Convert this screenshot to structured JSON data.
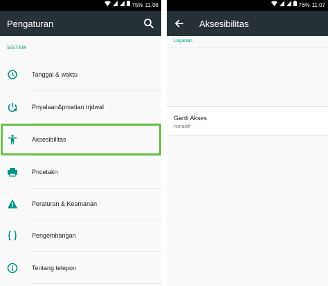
{
  "colors": {
    "toolbar": "#263238",
    "accent": "#009688",
    "highlight": "#6dbf4b",
    "icon": "#009688"
  },
  "left": {
    "status": {
      "battery": "75%",
      "time": "11.08"
    },
    "toolbar": {
      "title": "Pengaturan",
      "search_icon": "search-icon"
    },
    "section": "SISTEM",
    "items": [
      {
        "label": "Tanggal & waktu",
        "icon": "clock-icon"
      },
      {
        "label": "Pnyalaan&pmatian trjdwal",
        "icon": "power-schedule-icon"
      },
      {
        "label": "Aksesibilitas",
        "icon": "accessibility-icon",
        "highlighted": true
      },
      {
        "label": "Pncetakn",
        "icon": "printer-icon"
      },
      {
        "label": "Peraturan & Keamanan",
        "icon": "warning-icon"
      },
      {
        "label": "Pengembangan",
        "icon": "braces-icon"
      },
      {
        "label": "Tentang telepon",
        "icon": "info-icon"
      }
    ]
  },
  "right": {
    "status": {
      "battery": "76%",
      "time": "11.07"
    },
    "toolbar": {
      "title": "Aksesibilitas",
      "back_icon": "arrow-back-icon"
    },
    "section": "Layanan",
    "preference": {
      "title": "Ganti Akses",
      "summary": "nonaktif"
    }
  }
}
